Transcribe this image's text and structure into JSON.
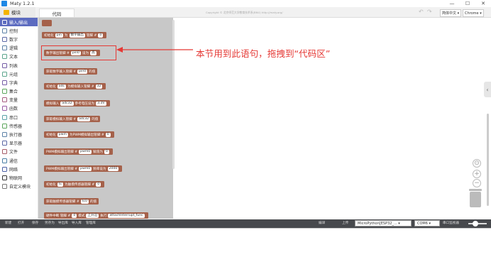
{
  "window": {
    "title": "Maty 1.2.1",
    "minimize": "—",
    "maximize": "☐",
    "close": "✕"
  },
  "header": {
    "blocks_tab": "模块",
    "code_tab": "代码",
    "copyright": "Copyright © 北京师范大学教育技术系(BNU) http://maty.org/",
    "undo": "↶",
    "redo": "↷",
    "language": "简体中文",
    "browser": "Chrome"
  },
  "sidebar": {
    "items": [
      {
        "label": "输入/输出",
        "color": "#a5614a",
        "active": true
      },
      {
        "label": "控制",
        "color": "#5c81a6"
      },
      {
        "label": "数字",
        "color": "#5c68a6"
      },
      {
        "label": "逻辑",
        "color": "#5c81a6"
      },
      {
        "label": "文本",
        "color": "#5ba58c"
      },
      {
        "label": "列表",
        "color": "#745ca6"
      },
      {
        "label": "元组",
        "color": "#5ba58c"
      },
      {
        "label": "字典",
        "color": "#745ca6"
      },
      {
        "label": "集合",
        "color": "#5ba55b"
      },
      {
        "label": "变量",
        "color": "#a55b80"
      },
      {
        "label": "函数",
        "color": "#995ba5"
      },
      {
        "label": "串口",
        "color": "#58a1a6"
      },
      {
        "label": "传感器",
        "color": "#5ca65c"
      },
      {
        "label": "执行器",
        "color": "#5c81a6"
      },
      {
        "label": "显示器",
        "color": "#5b67a5"
      },
      {
        "label": "文件",
        "color": "#a55b67"
      },
      {
        "label": "通信",
        "color": "#4a7fa5"
      },
      {
        "label": "网络",
        "color": "#4a5fa5"
      },
      {
        "label": "物联网",
        "color": "#333333"
      },
      {
        "label": "自定义模块",
        "color": "#777777"
      }
    ]
  },
  "blocks": [
    {
      "parts": [
        "初始化",
        "pin",
        "为",
        "数字输出",
        "管脚 #",
        "0"
      ]
    },
    {
      "parts": [
        "数字输出",
        "管脚 #",
        "pin0",
        "设为",
        "高"
      ]
    },
    {
      "parts": [
        "获取",
        "数字输入",
        "管脚 #",
        "pin0",
        "的值"
      ]
    },
    {
      "parts": [
        "初始化",
        "adc",
        "为",
        "模拟输入",
        "管脚 #",
        "32"
      ]
    },
    {
      "parts": [
        "模拟输入",
        "adc32",
        "参考电压设为",
        "3.3V"
      ]
    },
    {
      "parts": [
        "获取",
        "模拟输入",
        "管脚 #",
        "adc32",
        "的值"
      ]
    },
    {
      "parts": [
        "初始化",
        "pwm",
        "为",
        "PWM模拟输出",
        "管脚 #",
        "0"
      ]
    },
    {
      "parts": [
        "PWM模拟输出",
        "管脚 #",
        "pwm0",
        "赋值为",
        "0"
      ]
    },
    {
      "parts": [
        "PWM模拟输出",
        "管脚 #",
        "pwm0",
        "频率设为",
        "2000"
      ]
    },
    {
      "parts": [
        "初始化",
        "tc",
        "为",
        "触摸传感器",
        "管脚 #",
        "0"
      ]
    },
    {
      "parts": [
        "获取",
        "触摸传感器",
        "管脚 #",
        "tc0",
        "的值"
      ]
    },
    {
      "parts": [
        "硬件中断 管脚 #",
        "0",
        "模式",
        "上升沿",
        "执行",
        "attachInterrupt_func"
      ]
    }
  ],
  "annotation": "本节用到此语句，拖拽到“代码区”",
  "workspace": {
    "collapse": "‹",
    "zoom_in": "+",
    "zoom_out": "−",
    "zoom_reset": "⊙"
  },
  "bottombar": {
    "buttons": [
      "新建",
      "打开",
      "保存",
      "另存为",
      "导出库",
      "导入库",
      "管理库"
    ],
    "compile": "编译",
    "upload": "上传",
    "board": "MicroPython[ESP32_...",
    "port": "COM6",
    "serial_monitor": "串口监视器"
  }
}
